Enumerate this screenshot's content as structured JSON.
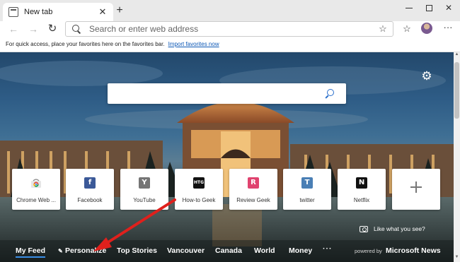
{
  "tab": {
    "title": "New tab",
    "close_glyph": "✕",
    "new_tab_glyph": "+"
  },
  "window": {
    "minimize": "minimize",
    "maximize": "maximize",
    "close_glyph": "✕"
  },
  "toolbar": {
    "back_glyph": "←",
    "forward_glyph": "→",
    "refresh_glyph": "↻",
    "address_placeholder": "Search or enter web address",
    "star_glyph": "☆",
    "favorites_glyph": "☆",
    "more_glyph": "···"
  },
  "favorites_bar": {
    "text": "For quick access, place your favorites here on the favorites bar.",
    "link": "Import favorites now"
  },
  "content": {
    "settings_icon": "⚙",
    "search_placeholder": "",
    "tiles": [
      {
        "label": "Chrome Web ...",
        "icon": "chrome-web-store-icon",
        "glyph": "",
        "color": "#ffffff"
      },
      {
        "label": "Facebook",
        "icon": "facebook-icon",
        "glyph": "f",
        "color": "#3b5998"
      },
      {
        "label": "YouTube",
        "icon": "youtube-icon",
        "glyph": "Y",
        "color": "#757575"
      },
      {
        "label": "How-to Geek",
        "icon": "how-to-geek-icon",
        "glyph": "HTG",
        "color": "#111111"
      },
      {
        "label": "Review Geek",
        "icon": "review-geek-icon",
        "glyph": "R",
        "color": "#e0436f"
      },
      {
        "label": "twitter",
        "icon": "twitter-icon",
        "glyph": "T",
        "color": "#4a7fb5"
      },
      {
        "label": "Netflix",
        "icon": "netflix-icon",
        "glyph": "N",
        "color": "#111111"
      },
      {
        "label": "",
        "icon": "add-site-icon",
        "glyph": "",
        "color": "#777777"
      }
    ],
    "like_text": "Like what you see?"
  },
  "newsbar": {
    "items": {
      "my_feed": "My Feed",
      "personalize": "Personalize",
      "top_stories": "Top Stories",
      "vancouver": "Vancouver",
      "canada": "Canada",
      "world": "World",
      "money": "Money",
      "more": "···"
    },
    "powered_by": "powered by",
    "brand": "Microsoft News"
  },
  "colors": {
    "accent": "#3a8ee6",
    "link": "#0b57b5",
    "annotation_arrow": "#e0201c"
  }
}
